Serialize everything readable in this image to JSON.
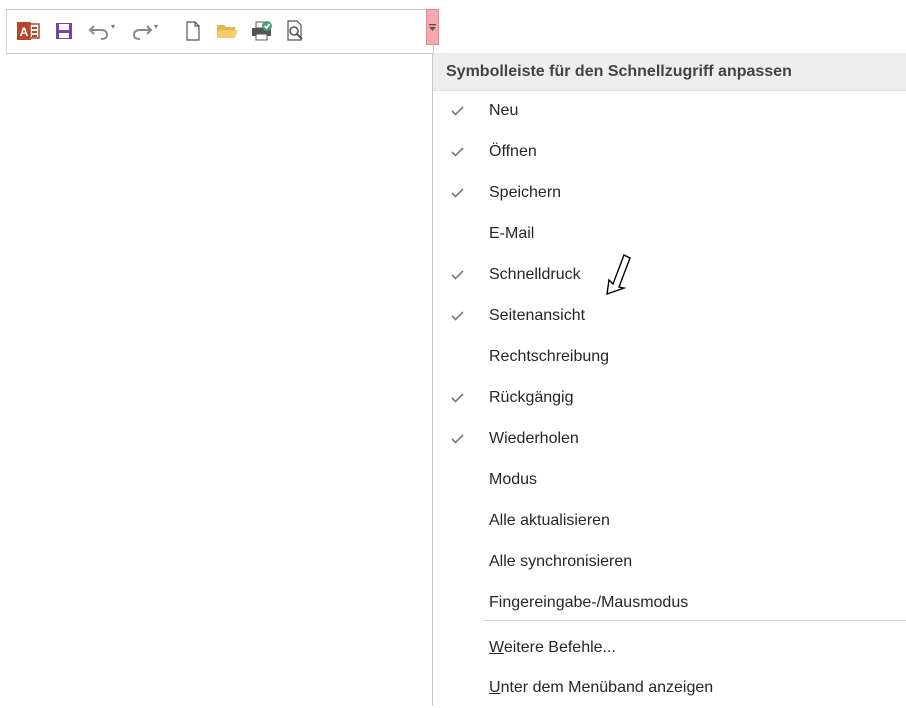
{
  "toolbar": {
    "icons": [
      "access-logo-icon",
      "save-icon",
      "undo-icon",
      "redo-icon",
      "new-document-icon",
      "open-folder-icon",
      "quick-print-icon",
      "print-preview-icon"
    ],
    "customize_button_icon": "dropdown-arrow-icon"
  },
  "menu": {
    "title": "Symbolleiste für den Schnellzugriff anpassen",
    "items": [
      {
        "label": "Neu",
        "checked": true
      },
      {
        "label": "Öffnen",
        "checked": true
      },
      {
        "label": "Speichern",
        "checked": true
      },
      {
        "label": "E-Mail",
        "checked": false
      },
      {
        "label": "Schnelldruck",
        "checked": true
      },
      {
        "label": "Seitenansicht",
        "checked": true
      },
      {
        "label": "Rechtschreibung",
        "checked": false
      },
      {
        "label": "Rückgängig",
        "checked": true
      },
      {
        "label": "Wiederholen",
        "checked": true
      },
      {
        "label": "Modus",
        "checked": false
      },
      {
        "label": "Alle aktualisieren",
        "checked": false
      },
      {
        "label": "Alle synchronisieren",
        "checked": false
      },
      {
        "label": "Fingereingabe-/Mausmodus",
        "checked": false
      }
    ],
    "more_commands": {
      "accel": "W",
      "rest": "eitere Befehle..."
    },
    "show_below": {
      "accel": "U",
      "rest": "nter dem Menüband anzeigen"
    }
  },
  "colors": {
    "access_red": "#b7472a",
    "save_purple": "#7b3fb0",
    "highlight_pink": "#f6a8ac",
    "check_gray": "#7a7a7a"
  }
}
